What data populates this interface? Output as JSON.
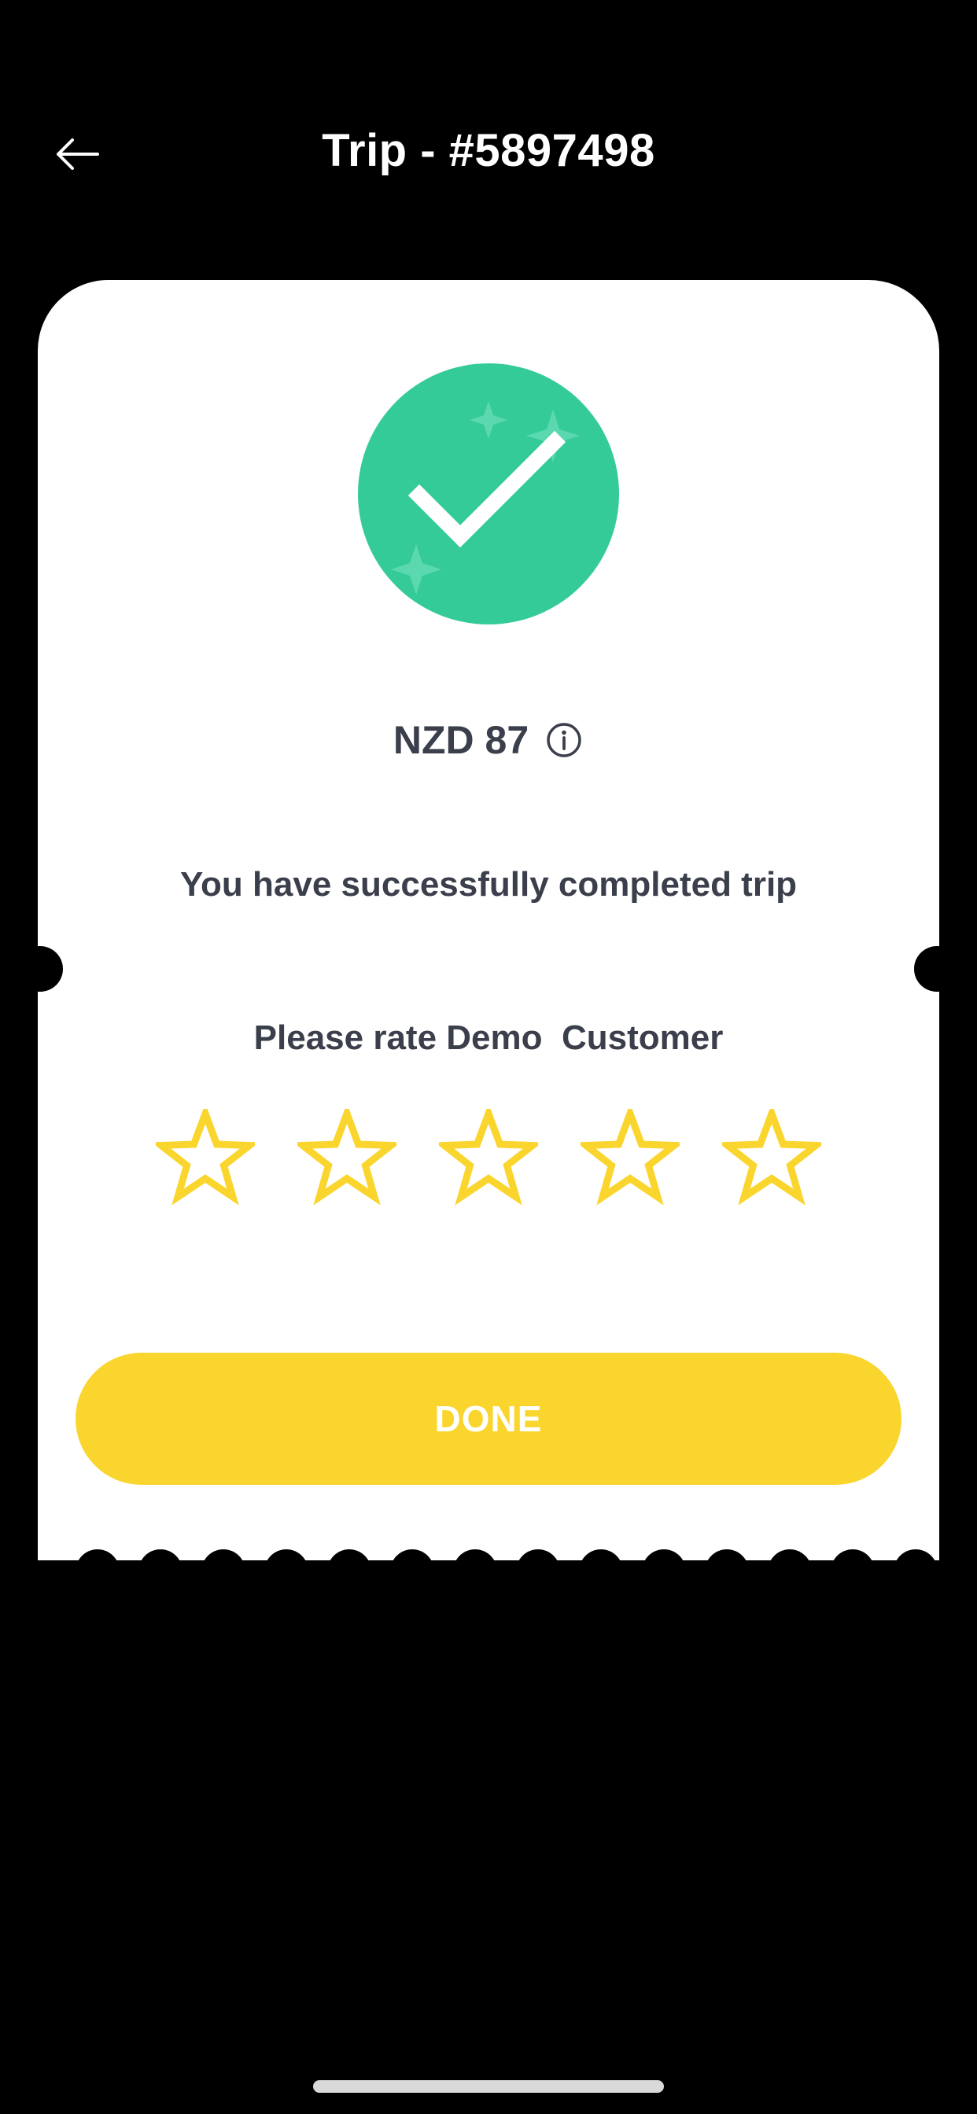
{
  "header": {
    "title": "Trip - #5897498",
    "back_icon": "arrow-left-icon"
  },
  "card": {
    "status_icon": "success-check-icon",
    "status_color": "#35cb99",
    "amount": "NZD 87",
    "info_icon": "info-icon",
    "message": "You have successfully completed trip",
    "rating": {
      "prompt": "Please rate Demo  Customer",
      "max_stars": 5,
      "current_rating": 0,
      "star_color": "#fad52e"
    },
    "done_button": {
      "label": "DONE",
      "color": "#fad52e"
    }
  }
}
